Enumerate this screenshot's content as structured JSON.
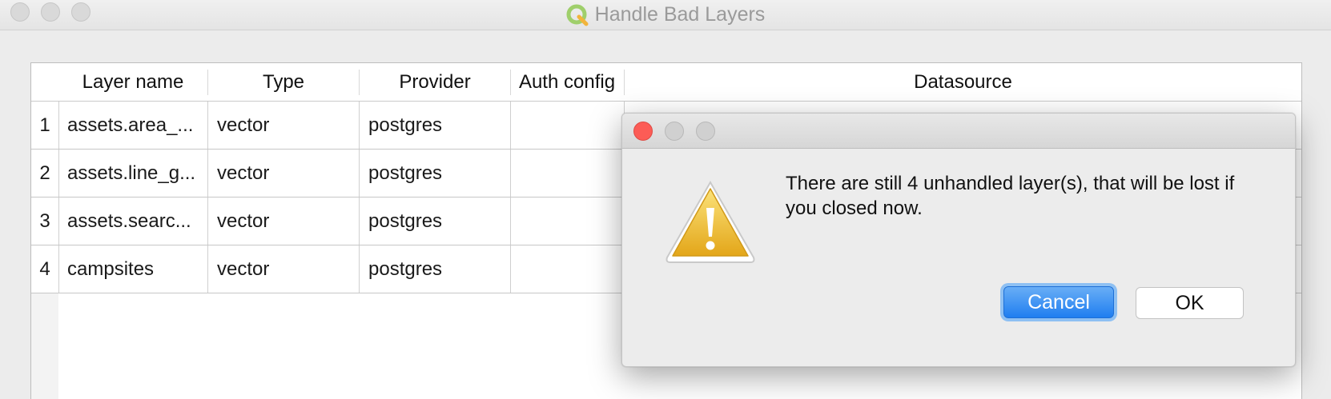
{
  "window": {
    "title": "Handle Bad Layers"
  },
  "table": {
    "headers": [
      "Layer name",
      "Type",
      "Provider",
      "Auth config",
      "Datasource"
    ],
    "rows": [
      {
        "num": "1",
        "name": "assets.area_...",
        "type": "vector",
        "provider": "postgres",
        "auth": ""
      },
      {
        "num": "2",
        "name": "assets.line_g...",
        "type": "vector",
        "provider": "postgres",
        "auth": ""
      },
      {
        "num": "3",
        "name": "assets.searc...",
        "type": "vector",
        "provider": "postgres",
        "auth": ""
      },
      {
        "num": "4",
        "name": "campsites",
        "type": "vector",
        "provider": "postgres",
        "auth": ""
      }
    ]
  },
  "dialog": {
    "message": "There are still 4 unhandled layer(s), that will be lost if you closed now.",
    "icon": "warning-icon",
    "cancel_label": "Cancel",
    "ok_label": "OK"
  },
  "colors": {
    "accent": "#1f7ef0",
    "close_red": "#fc5c56",
    "warning_yellow": "#f0c22e"
  }
}
